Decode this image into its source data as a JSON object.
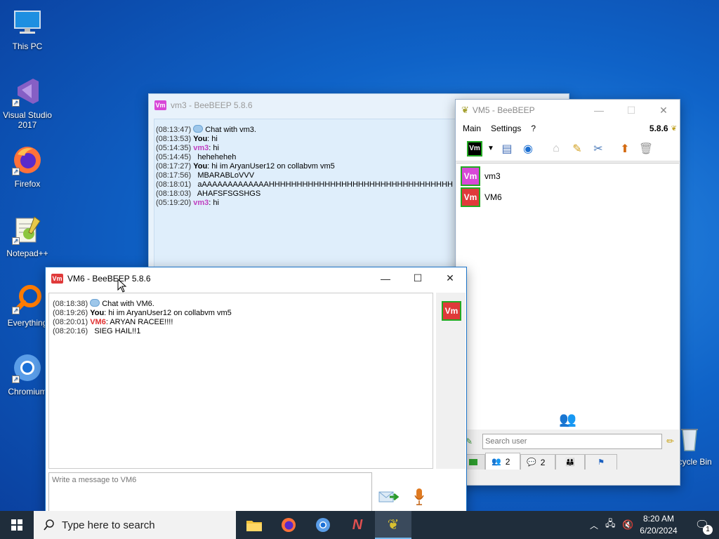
{
  "desktop": {
    "icons": [
      {
        "label": "This PC",
        "icon": "computer-icon"
      },
      {
        "label": "Visual Studio 2017",
        "icon": "visual-studio-icon"
      },
      {
        "label": "Firefox",
        "icon": "firefox-icon"
      },
      {
        "label": "Notepad++",
        "icon": "notepadpp-icon"
      },
      {
        "label": "Everything",
        "icon": "everything-icon"
      },
      {
        "label": "Chromium",
        "icon": "chromium-icon"
      },
      {
        "label": "Recycle Bin",
        "icon": "recycle-bin-icon"
      }
    ]
  },
  "vm3_window": {
    "title": "vm3 - BeeBEEP 5.8.6",
    "messages": [
      {
        "ts": "(08:13:47)",
        "sender": "",
        "text": "Chat with vm3.",
        "system": true
      },
      {
        "ts": "(08:13:53)",
        "sender": "You",
        "text": "hi"
      },
      {
        "ts": "(05:14:35)",
        "sender": "vm3",
        "text": "hi"
      },
      {
        "ts": "(05:14:45)",
        "sender": "",
        "text": "heheheheh"
      },
      {
        "ts": "(08:17:27)",
        "sender": "You",
        "text": "hi im AryanUser12 on collabvm vm5"
      },
      {
        "ts": "(08:17:56)",
        "sender": "",
        "text": "MBARABLoVVV"
      },
      {
        "ts": "(08:18:01)",
        "sender": "",
        "text": "aAAAAAAAAAAAAAHHHHHHHHHHHHHHHHHHHHHHHHHHHHHHHHH"
      },
      {
        "ts": "(08:18:03)",
        "sender": "",
        "text": "AHAFSFSGSHGS"
      },
      {
        "ts": "(05:19:20)",
        "sender": "vm3",
        "text": "hi"
      }
    ]
  },
  "vm5_window": {
    "title": "VM5 - BeeBEEP",
    "menu": [
      "Main",
      "Settings",
      "?"
    ],
    "version": "5.8.6",
    "users": [
      {
        "name": "vm3",
        "badge": "Vm",
        "color": "#d848d8"
      },
      {
        "name": "VM6",
        "badge": "Vm",
        "color": "#e03a3a"
      }
    ],
    "search_placeholder": "Search user",
    "tabs": [
      {
        "icon": "users-icon",
        "count": "2"
      },
      {
        "icon": "chats-icon",
        "count": "2"
      },
      {
        "icon": "groups-icon",
        "count": ""
      },
      {
        "icon": "share-icon",
        "count": ""
      }
    ],
    "status_badge": "Vm"
  },
  "vm6_window": {
    "title": "VM6 - BeeBEEP 5.8.6",
    "messages": [
      {
        "ts": "(08:18:38)",
        "sender": "",
        "text": "Chat with VM6.",
        "system": true
      },
      {
        "ts": "(08:19:26)",
        "sender": "You",
        "text": "hi im AryanUser12 on collabvm vm5"
      },
      {
        "ts": "(08:20:01)",
        "sender": "VM6",
        "text": "ARYAN RACEE!!!!"
      },
      {
        "ts": "(08:20:16)",
        "sender": "",
        "text": "SIEG HAIL!!1"
      }
    ],
    "input_placeholder": "Write a message to VM6",
    "side_badge": "Vm"
  },
  "taskbar": {
    "search_placeholder": "Type here to search",
    "time": "8:20 AM",
    "date": "6/20/2024",
    "notification_count": "1"
  }
}
